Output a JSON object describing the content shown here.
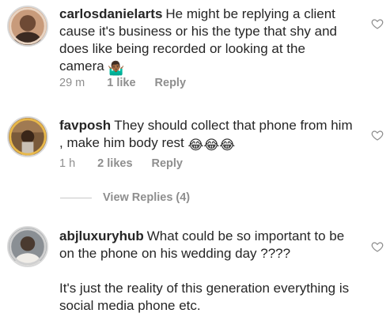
{
  "comments": [
    {
      "username": "carlosdanielarts",
      "text": "He might be replying a client cause it's business or his the type that shy and does like being recorded or looking at the camera",
      "emoji": "🤷🏾‍♂️",
      "time": "29 m",
      "likes": "1 like",
      "reply": "Reply"
    },
    {
      "username": "favposh",
      "text": "They should collect that phone from him , make him body rest",
      "emoji": "😂😂😂",
      "time": "1 h",
      "likes": "2 likes",
      "reply": "Reply"
    },
    {
      "username": "abjluxuryhub",
      "text": "What could be so important to be on the phone on his wedding day ????\n\nIt's just the reality of this generation everything is social media phone etc."
    }
  ],
  "view_replies": "View Replies (4)",
  "icons": {
    "like": "heart-outline-icon"
  }
}
